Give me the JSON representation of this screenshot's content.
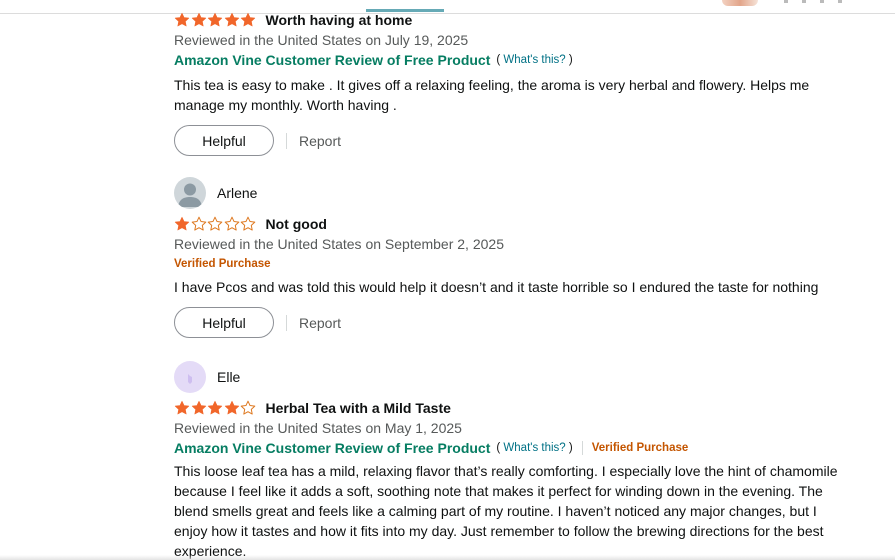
{
  "colors": {
    "star_filled": "#f1662a",
    "star_empty_stroke": "#de7921",
    "vine_green": "#067d62",
    "verified_orange": "#c45500",
    "link_teal": "#007185",
    "meta_grey": "#565959"
  },
  "reviews": [
    {
      "rating": 5,
      "rating_max": 5,
      "title": "Worth having at home",
      "date": "Reviewed in the United States on July 19, 2025",
      "vine_label": "Amazon Vine Customer Review of Free Product",
      "whats_this_open": "(",
      "whats_this": "What's this?",
      "whats_this_close": ")",
      "body": "This tea is easy to make . It gives off a relaxing feeling, the aroma is very herbal and flowery. Helps me manage my monthly. Worth having .",
      "helpful_label": "Helpful",
      "report_label": "Report"
    },
    {
      "reviewer": "Arlene",
      "avatar_icon": "default-profile-icon",
      "rating": 1,
      "rating_max": 5,
      "title": "Not good",
      "date": "Reviewed in the United States on September 2, 2025",
      "verified_label": "Verified Purchase",
      "body": "I have Pcos and was told this would help it doesn’t and it taste horrible so I endured the taste for nothing",
      "helpful_label": "Helpful",
      "report_label": "Report"
    },
    {
      "reviewer": "Elle",
      "avatar_icon": "default-profile-icon",
      "rating": 4,
      "rating_max": 5,
      "title": "Herbal Tea with a Mild Taste",
      "date": "Reviewed in the United States on May 1, 2025",
      "vine_label": "Amazon Vine Customer Review of Free Product",
      "whats_this_open": "(",
      "whats_this": "What's this?",
      "whats_this_close": ")",
      "verified_label": "Verified Purchase",
      "body": "This loose leaf tea has a mild, relaxing flavor that’s really comforting. I especially love the hint of chamomile because I feel like it adds a soft, soothing note that makes it perfect for winding down in the evening. The blend smells great and feels like a calming part of my routine. I haven’t noticed any major changes, but I enjoy how it tastes and how it fits into my day. Just remember to follow the brewing directions for the best experience."
    }
  ]
}
